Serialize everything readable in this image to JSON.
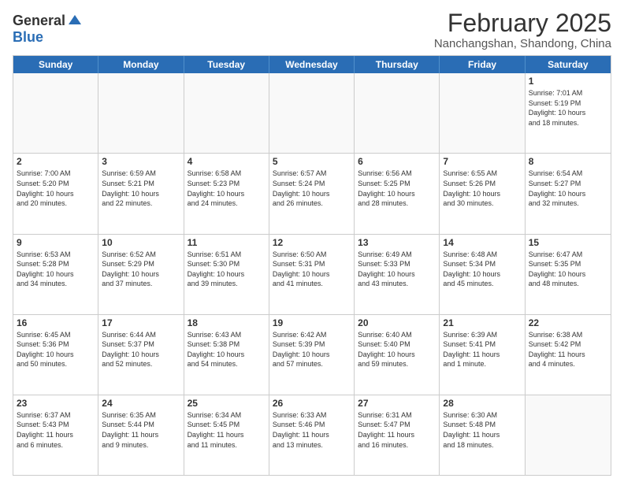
{
  "logo": {
    "general": "General",
    "blue": "Blue"
  },
  "title": "February 2025",
  "location": "Nanchangshan, Shandong, China",
  "weekdays": [
    "Sunday",
    "Monday",
    "Tuesday",
    "Wednesday",
    "Thursday",
    "Friday",
    "Saturday"
  ],
  "weeks": [
    [
      {
        "day": "",
        "info": ""
      },
      {
        "day": "",
        "info": ""
      },
      {
        "day": "",
        "info": ""
      },
      {
        "day": "",
        "info": ""
      },
      {
        "day": "",
        "info": ""
      },
      {
        "day": "",
        "info": ""
      },
      {
        "day": "1",
        "info": "Sunrise: 7:01 AM\nSunset: 5:19 PM\nDaylight: 10 hours\nand 18 minutes."
      }
    ],
    [
      {
        "day": "2",
        "info": "Sunrise: 7:00 AM\nSunset: 5:20 PM\nDaylight: 10 hours\nand 20 minutes."
      },
      {
        "day": "3",
        "info": "Sunrise: 6:59 AM\nSunset: 5:21 PM\nDaylight: 10 hours\nand 22 minutes."
      },
      {
        "day": "4",
        "info": "Sunrise: 6:58 AM\nSunset: 5:23 PM\nDaylight: 10 hours\nand 24 minutes."
      },
      {
        "day": "5",
        "info": "Sunrise: 6:57 AM\nSunset: 5:24 PM\nDaylight: 10 hours\nand 26 minutes."
      },
      {
        "day": "6",
        "info": "Sunrise: 6:56 AM\nSunset: 5:25 PM\nDaylight: 10 hours\nand 28 minutes."
      },
      {
        "day": "7",
        "info": "Sunrise: 6:55 AM\nSunset: 5:26 PM\nDaylight: 10 hours\nand 30 minutes."
      },
      {
        "day": "8",
        "info": "Sunrise: 6:54 AM\nSunset: 5:27 PM\nDaylight: 10 hours\nand 32 minutes."
      }
    ],
    [
      {
        "day": "9",
        "info": "Sunrise: 6:53 AM\nSunset: 5:28 PM\nDaylight: 10 hours\nand 34 minutes."
      },
      {
        "day": "10",
        "info": "Sunrise: 6:52 AM\nSunset: 5:29 PM\nDaylight: 10 hours\nand 37 minutes."
      },
      {
        "day": "11",
        "info": "Sunrise: 6:51 AM\nSunset: 5:30 PM\nDaylight: 10 hours\nand 39 minutes."
      },
      {
        "day": "12",
        "info": "Sunrise: 6:50 AM\nSunset: 5:31 PM\nDaylight: 10 hours\nand 41 minutes."
      },
      {
        "day": "13",
        "info": "Sunrise: 6:49 AM\nSunset: 5:33 PM\nDaylight: 10 hours\nand 43 minutes."
      },
      {
        "day": "14",
        "info": "Sunrise: 6:48 AM\nSunset: 5:34 PM\nDaylight: 10 hours\nand 45 minutes."
      },
      {
        "day": "15",
        "info": "Sunrise: 6:47 AM\nSunset: 5:35 PM\nDaylight: 10 hours\nand 48 minutes."
      }
    ],
    [
      {
        "day": "16",
        "info": "Sunrise: 6:45 AM\nSunset: 5:36 PM\nDaylight: 10 hours\nand 50 minutes."
      },
      {
        "day": "17",
        "info": "Sunrise: 6:44 AM\nSunset: 5:37 PM\nDaylight: 10 hours\nand 52 minutes."
      },
      {
        "day": "18",
        "info": "Sunrise: 6:43 AM\nSunset: 5:38 PM\nDaylight: 10 hours\nand 54 minutes."
      },
      {
        "day": "19",
        "info": "Sunrise: 6:42 AM\nSunset: 5:39 PM\nDaylight: 10 hours\nand 57 minutes."
      },
      {
        "day": "20",
        "info": "Sunrise: 6:40 AM\nSunset: 5:40 PM\nDaylight: 10 hours\nand 59 minutes."
      },
      {
        "day": "21",
        "info": "Sunrise: 6:39 AM\nSunset: 5:41 PM\nDaylight: 11 hours\nand 1 minute."
      },
      {
        "day": "22",
        "info": "Sunrise: 6:38 AM\nSunset: 5:42 PM\nDaylight: 11 hours\nand 4 minutes."
      }
    ],
    [
      {
        "day": "23",
        "info": "Sunrise: 6:37 AM\nSunset: 5:43 PM\nDaylight: 11 hours\nand 6 minutes."
      },
      {
        "day": "24",
        "info": "Sunrise: 6:35 AM\nSunset: 5:44 PM\nDaylight: 11 hours\nand 9 minutes."
      },
      {
        "day": "25",
        "info": "Sunrise: 6:34 AM\nSunset: 5:45 PM\nDaylight: 11 hours\nand 11 minutes."
      },
      {
        "day": "26",
        "info": "Sunrise: 6:33 AM\nSunset: 5:46 PM\nDaylight: 11 hours\nand 13 minutes."
      },
      {
        "day": "27",
        "info": "Sunrise: 6:31 AM\nSunset: 5:47 PM\nDaylight: 11 hours\nand 16 minutes."
      },
      {
        "day": "28",
        "info": "Sunrise: 6:30 AM\nSunset: 5:48 PM\nDaylight: 11 hours\nand 18 minutes."
      },
      {
        "day": "",
        "info": ""
      }
    ]
  ]
}
